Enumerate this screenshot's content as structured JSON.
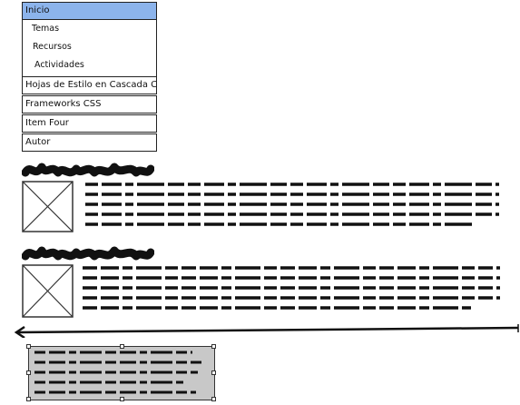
{
  "menu": {
    "active_label": "Inicio",
    "sub_items": [
      {
        "label": "Temas"
      },
      {
        "label": "Recursos"
      },
      {
        "label": "Actividades"
      }
    ],
    "items": [
      {
        "label": "Hojas de Estilo en Cascada CSS"
      },
      {
        "label": "Frameworks CSS"
      },
      {
        "label": "Item Four"
      },
      {
        "label": "Autor"
      }
    ]
  },
  "content_blocks": [
    {
      "heading_icon": "scribbled-heading",
      "image_icon": "image-placeholder-icon",
      "text_icon": "scribbled-paragraph"
    },
    {
      "heading_icon": "scribbled-heading",
      "image_icon": "image-placeholder-icon",
      "text_icon": "scribbled-paragraph"
    }
  ],
  "divider_icon": "left-arrow-line",
  "annotation_icon": "scribbled-note",
  "colors": {
    "active_menu_bg": "#8cb4ec",
    "annotation_bg": "#c8c8c8",
    "ink": "#111111"
  }
}
